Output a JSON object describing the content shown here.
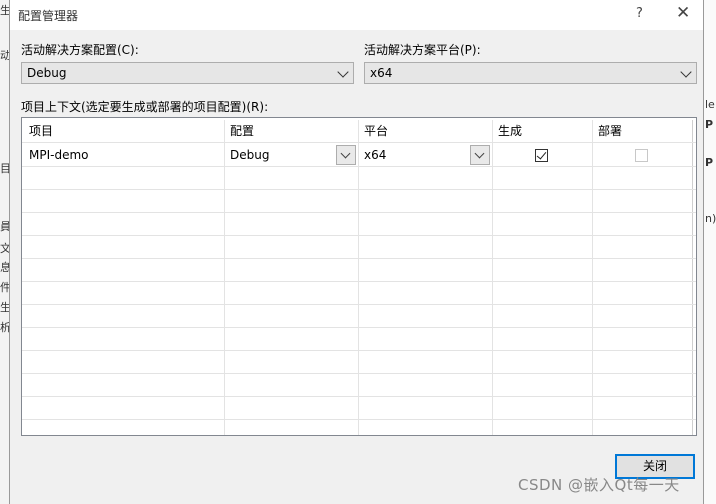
{
  "background": {
    "left_chars": [
      "目",
      "員",
      "文",
      "息",
      "件",
      "生",
      "析"
    ],
    "right_chars": [
      "le",
      "P",
      "P",
      "n)"
    ],
    "top_left": "生",
    "mid_left": "动"
  },
  "dialog": {
    "title": "配置管理器",
    "help_symbol": "?",
    "close_symbol": "✕"
  },
  "active_config": {
    "label": "活动解决方案配置(C):",
    "value": "Debug"
  },
  "active_platform": {
    "label": "活动解决方案平台(P):",
    "value": "x64"
  },
  "project_context": {
    "label": "项目上下文(选定要生成或部署的项目配置)(R):",
    "columns": [
      "项目",
      "配置",
      "平台",
      "生成",
      "部署"
    ],
    "rows": [
      {
        "project": "MPI-demo",
        "config": "Debug",
        "platform": "x64",
        "build": true,
        "deploy": false
      }
    ]
  },
  "buttons": {
    "close": "关闭"
  },
  "watermark": "CSDN @嵌入Qt每一天"
}
